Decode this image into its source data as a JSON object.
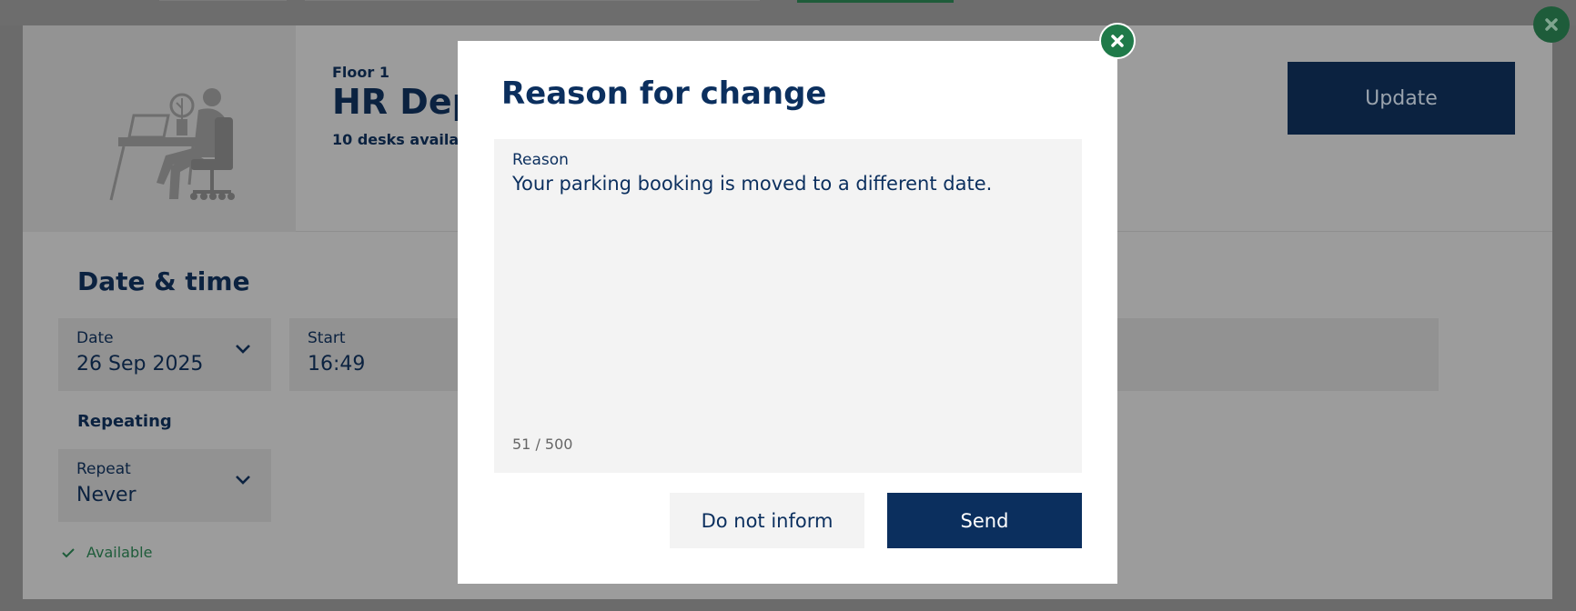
{
  "background": {
    "floor_label": "Floor 1",
    "room_title": "HR Dep",
    "desks_available": "10 desks availab",
    "update_label": "Update",
    "section_title": "Date & time",
    "date": {
      "label": "Date",
      "value": "26 Sep 2025"
    },
    "start": {
      "label": "Start",
      "value": "16:49"
    },
    "repeating_label": "Repeating",
    "repeat": {
      "label": "Repeat",
      "value": "Never"
    },
    "available_label": "Available"
  },
  "modal": {
    "title": "Reason for change",
    "reason_label": "Reason",
    "reason_text": "Your parking booking is moved to a different date.",
    "counter": "51 / 500",
    "do_not_inform_label": "Do not inform",
    "send_label": "Send"
  },
  "icons": {
    "modal_close": "close-icon",
    "outer_close": "close-icon",
    "date_chevron": "chevron-down-icon",
    "repeat_chevron": "chevron-down-icon",
    "available_check": "check-icon",
    "illustration": "desk-worker-illustration"
  },
  "colors": {
    "brand_navy": "#0b2f5e",
    "accent_green": "#1f7a49",
    "overlay_gray": "#9c9c9c"
  }
}
